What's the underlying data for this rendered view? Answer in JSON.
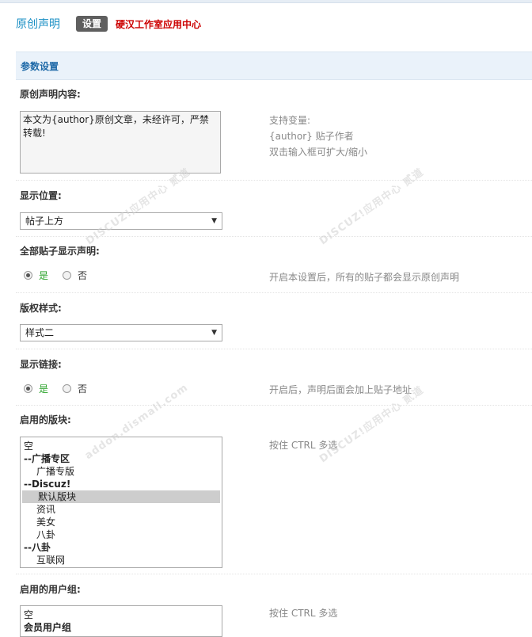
{
  "header": {
    "title": "原创声明",
    "tab_settings": "设置",
    "center_link": "硬汉工作室应用中心"
  },
  "panel": {
    "title": "参数设置"
  },
  "fields": {
    "content": {
      "label": "原创声明内容:",
      "value": "本文为{author}原创文章，未经许可，严禁转载!",
      "hint_lines": [
        "支持变量:",
        "{author} 贴子作者",
        "双击输入框可扩大/缩小"
      ]
    },
    "position": {
      "label": "显示位置:",
      "value": "帖子上方"
    },
    "all_posts": {
      "label": "全部贴子显示声明:",
      "yes": "是",
      "no": "否",
      "selected": "是",
      "hint": "开启本设置后，所有的贴子都会显示原创声明"
    },
    "style": {
      "label": "版权样式:",
      "value": "样式二"
    },
    "show_link": {
      "label": "显示链接:",
      "yes": "是",
      "no": "否",
      "selected": "是",
      "hint": "开启后，声明后面会加上贴子地址"
    },
    "forums": {
      "label": "启用的版块:",
      "hint": "按住 CTRL 多选",
      "options": [
        {
          "text": "空",
          "kind": "plain",
          "selected": false
        },
        {
          "text": "--广播专区",
          "kind": "group",
          "selected": false
        },
        {
          "text": "广播专版",
          "kind": "child",
          "selected": false
        },
        {
          "text": "--Discuz!",
          "kind": "group",
          "selected": false
        },
        {
          "text": "默认版块",
          "kind": "child",
          "selected": true
        },
        {
          "text": "资讯",
          "kind": "child",
          "selected": false
        },
        {
          "text": "美女",
          "kind": "child",
          "selected": false
        },
        {
          "text": "八卦",
          "kind": "child",
          "selected": false
        },
        {
          "text": "--八卦",
          "kind": "group",
          "selected": false
        },
        {
          "text": "互联网",
          "kind": "child",
          "selected": false
        }
      ]
    },
    "usergroups": {
      "label": "启用的用户组:",
      "hint": "按住 CTRL 多选",
      "options": [
        {
          "text": "空",
          "kind": "plain",
          "selected": false
        },
        {
          "text": "会员用户组",
          "kind": "group",
          "selected": false
        }
      ]
    }
  },
  "watermark": {
    "brand": "DISCUZ!应用中心",
    "domain": "addon.dismall.com",
    "mark": "贰道"
  },
  "colors": {
    "accent": "#1a8fc4",
    "link_red": "#cc0000",
    "yes_green": "#2aa32a",
    "panel_bg": "#eaf2fa"
  }
}
